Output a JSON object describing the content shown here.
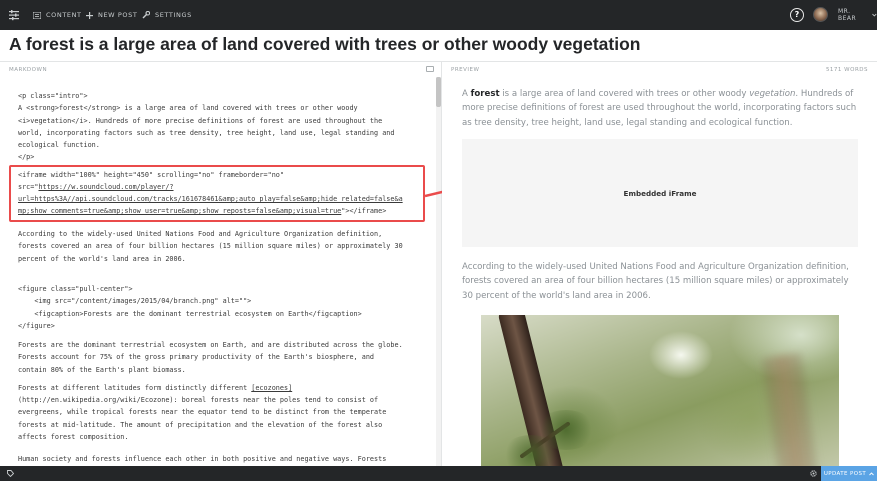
{
  "nav": {
    "content_label": "CONTENT",
    "new_post_label": "NEW POST",
    "settings_label": "SETTINGS",
    "help_label": "?",
    "username": "MR. BEAR"
  },
  "post": {
    "title": "A forest is a large area of land covered with trees or other woody vegetation"
  },
  "editor": {
    "header_label": "MARKDOWN",
    "lines_intro": "<p class=\"intro\">\nA <strong>forest</strong> is a large area of land covered with trees or other woody\n<i>vegetation</i>. Hundreds of more precise definitions of forest are used throughout the\nworld, incorporating factors such as tree density, tree height, land use, legal standing and\necological function.\n</p>",
    "iframe_line1": "<iframe width=\"100%\" height=\"450\" scrolling=\"no\" frameborder=\"no\"",
    "iframe_line2_prefix": "src=\"",
    "iframe_line2_link": "https://w.soundcloud.com/player/?",
    "iframe_line3_link": "url=https%3A//api.soundcloud.com/tracks/161678461&amp;auto_play=false&amp;hide_related=false&a",
    "iframe_line4_link": "mp;show_comments=true&amp;show_user=true&amp;show_reposts=false&amp;visual=true",
    "iframe_line4_suffix": "\"></iframe>",
    "lines_fao": "According to the widely-used United Nations Food and Agriculture Organization definition,\nforests covered an area of four billion hectares (15 million square miles) or approximately 30\npercent of the world's land area in 2006.",
    "lines_figure": "<figure class=\"pull-center\">\n    <img src=\"/content/images/2015/04/branch.png\" alt=\"\">\n    <figcaption>Forests are the dominant terrestrial ecosystem on Earth</figcaption>\n</figure>",
    "lines_dominant": "Forests are the dominant terrestrial ecosystem on Earth, and are distributed across the globe.\nForests account for 75% of the gross primary productivity of the Earth's biosphere, and\ncontain 80% of the Earth's plant biomass.",
    "eco_line1_prefix": "Forests at different latitudes form distinctly different ",
    "eco_line1_link": "[ecozones]",
    "lines_ecozones_rest": "(http://en.wikipedia.org/wiki/Ecozone): boreal forests near the poles tend to consist of\nevergreens, while tropical forests near the equator tend to be distinct from the temperate\nforests at mid-latitude. The amount of precipitation and the elevation of the forest also\naffects forest composition.",
    "lines_human": "Human society and forests influence each other in both positive and negative ways. Forests"
  },
  "preview": {
    "header_label": "PREVIEW",
    "word_count": "5171 WORDS",
    "intro_a": "A ",
    "intro_forest": "forest",
    "intro_mid": " is a large area of land covered with trees or other woody ",
    "intro_vegetation": "vegetation",
    "intro_rest": ". Hundreds of more precise definitions of forest are used throughout the world, incorporating factors such as tree density, tree height, land use, legal standing and ecological function.",
    "embed_label": "Embedded iFrame",
    "fao_paragraph": "According to the widely-used United Nations Food and Agriculture Organization definition, forests covered an area of four billion hectares (15 million square miles) or approximately 30 percent of the world's land area in 2006."
  },
  "footer": {
    "update_label": "UPDATE POST"
  },
  "colors": {
    "topbar": "#242628",
    "accent_blue": "#5ba4e5",
    "highlight_red": "#ea4b4b"
  },
  "icons": [
    "menu-icon",
    "content-icon",
    "plus-icon",
    "settings-icon",
    "help-icon",
    "avatar",
    "chevron-down-icon",
    "expand-icon",
    "tag-icon",
    "gear-icon"
  ]
}
